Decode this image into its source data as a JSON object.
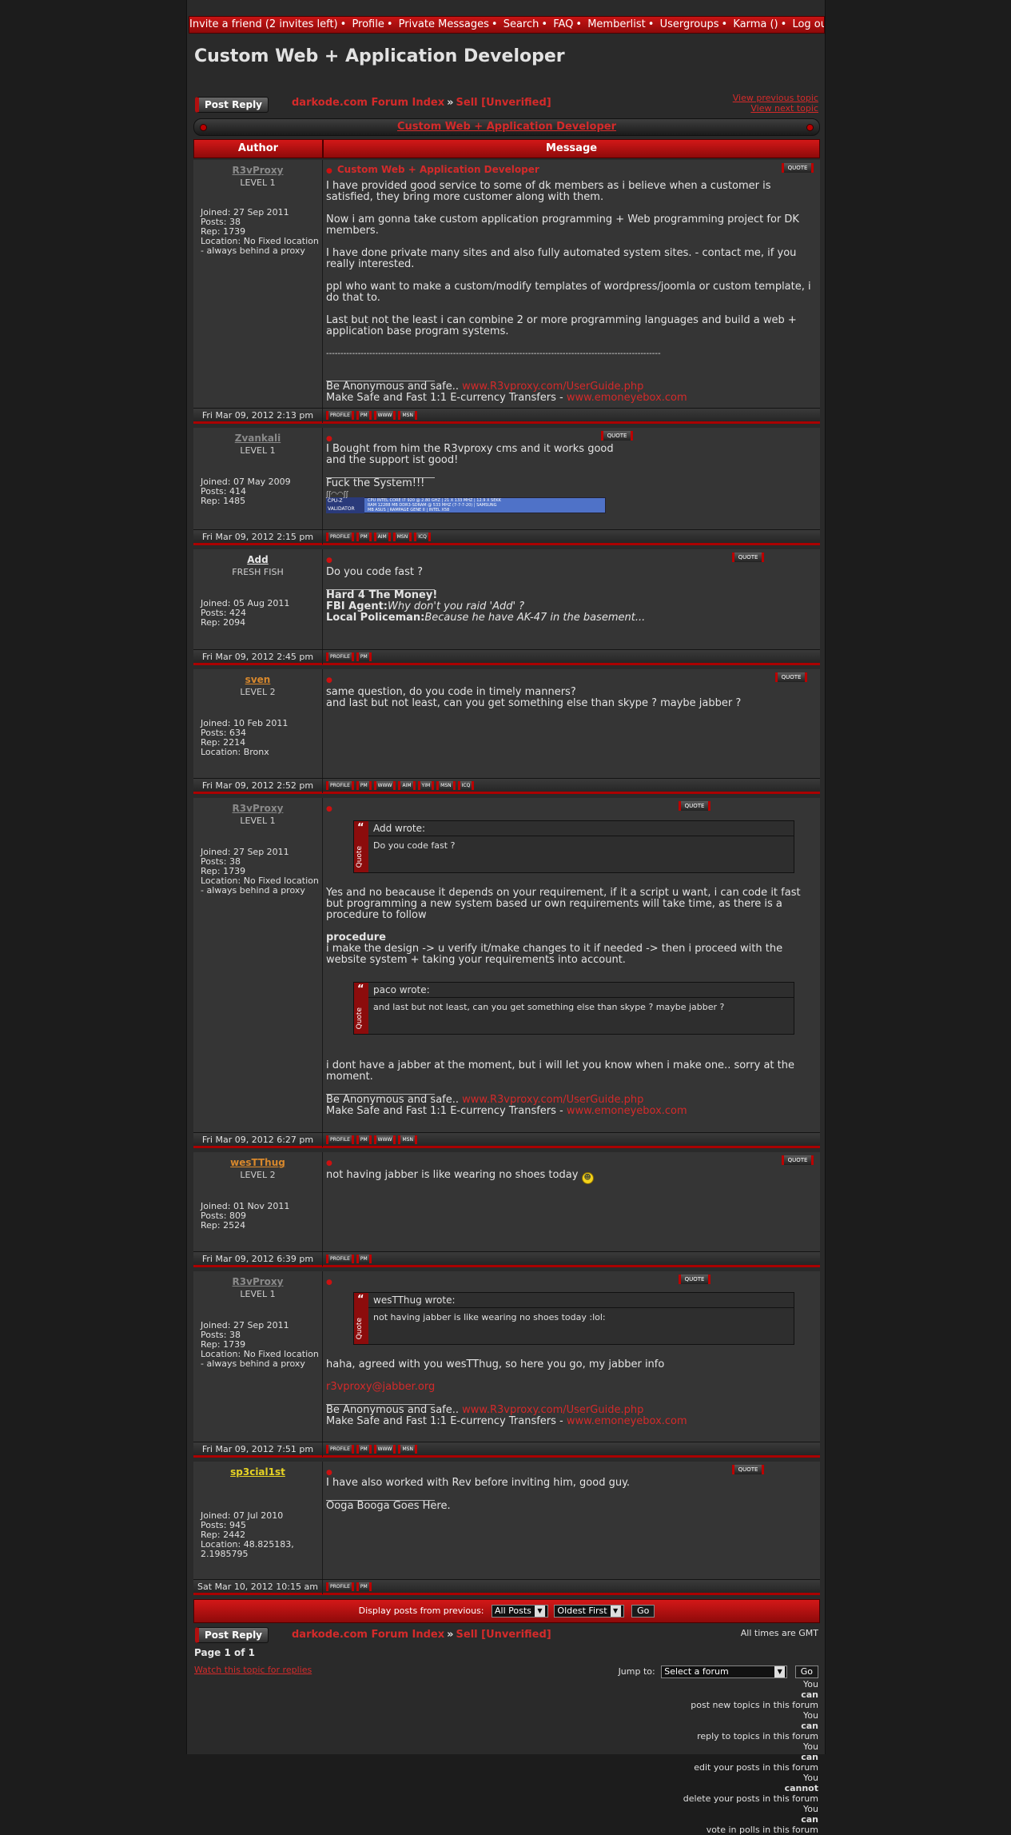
{
  "topnav": {
    "items": [
      "Invite a friend (2 invites left)",
      "Profile",
      "Private Messages",
      "Search",
      "FAQ",
      "Memberlist",
      "Usergroups",
      "Karma ()",
      "Log out [ Nassef ]"
    ]
  },
  "page_title": "Custom Web + Application Developer",
  "post_reply_label": "Post Reply",
  "breadcrumb": {
    "forum_index": "darkode.com Forum Index",
    "separator": "»",
    "forum": "Sell [Unverified]"
  },
  "view_previous": "View previous topic",
  "view_next": "View next topic",
  "topic_bar_title": "Custom Web + Application Developer",
  "table_head": {
    "author": "Author",
    "message": "Message"
  },
  "quote_btn": "QUOTE",
  "btn_labels": {
    "profile": "PROFILE",
    "pm": "PM",
    "www": "WWW",
    "aim": "AIM",
    "yim": "YIM",
    "msn": "MSN",
    "icq": "ICQ"
  },
  "quote_side": "Quote",
  "posts": [
    {
      "author": "R3vProxy",
      "rank": "LEVEL 1",
      "stats": [
        "Joined: 27 Sep 2011",
        "Posts: 38",
        "Rep: 1739",
        "Location: No Fixed location - always behind a proxy"
      ],
      "subject": "Custom Web + Application Developer",
      "paragraphs": [
        "I have provided good service to some of dk members as i believe when a customer is satisfied, they bring more customer along with them.",
        "Now i am gonna take custom application programming + Web programming project for DK members.",
        "I have done private many sites and also fully automated system sites. - contact me, if you really interested.",
        "ppl who want to make a custom/modify templates of wordpress/joomla or custom template, i do that to.",
        "Last but not the least i can combine 2 or more programming languages and build a web + application base program systems.",
        "--------------------------------------------------------------------------------------------------------------------"
      ],
      "sig1": "Be Anonymous and safe..",
      "sig1_link": "www.R3vproxy.com/UserGuide.php",
      "sig2": "Make Safe and Fast 1:1 E-currency Transfers -",
      "sig2_link": "www.emoneyebox.com",
      "date": "Fri Mar 09, 2012 2:13 pm"
    },
    {
      "author": "Zvankali",
      "rank": "LEVEL 1",
      "stats": [
        "Joined: 07 May 2009",
        "Posts: 414",
        "Rep: 1485"
      ],
      "paragraphs": [
        "I Bought from him the R3vproxy cms and it works good",
        "and the support ist good!"
      ],
      "sig": "Fuck the System!!!",
      "cpuz_label": "CPU-Z VALIDATOR",
      "cpuz_lines": [
        "CPU INTEL CORE I7 920 @ 2.80 GHZ | 21 X 133 MHZ | 12.9 X SEKK",
        "RAM 12288 MB DDR3-SDRAM @ 533 MHZ (7-7-7-20) | SAMSUNG",
        "MB ASUS | RAMPAGE GENE II | INTEL X58"
      ],
      "date": "Fri Mar 09, 2012 2:15 pm"
    },
    {
      "author": "Add",
      "rank": "FRESH FISH",
      "stats": [
        "Joined: 05 Aug 2011",
        "Posts: 424",
        "Rep: 2094"
      ],
      "text": "Do you code fast ?",
      "sig_a": "Hard 4 The Money!",
      "sig_b_label": "FBI Agent:",
      "sig_b": "Why don't you raid 'Add' ?",
      "sig_c_label": "Local Policeman:",
      "sig_c": "Because he have AK-47 in the basement...",
      "date": "Fri Mar 09, 2012 2:45 pm"
    },
    {
      "author": "sven",
      "rank": "LEVEL 2",
      "stats": [
        "Joined: 10 Feb 2011",
        "Posts: 634",
        "Rep: 2214",
        "Location: Bronx"
      ],
      "paragraphs": [
        "same question, do you code in timely manners?",
        "and last but not least, can you get something else than skype ? maybe jabber ?"
      ],
      "date": "Fri Mar 09, 2012 2:52 pm"
    },
    {
      "author": "R3vProxy",
      "rank": "LEVEL 1",
      "stats": [
        "Joined: 27 Sep 2011",
        "Posts: 38",
        "Rep: 1739",
        "Location: No Fixed location - always behind a proxy"
      ],
      "quote1_head": "Add wrote:",
      "quote1_body": "Do you code fast ?",
      "para1": "Yes and no beacause it depends on your requirement, if it a script u want, i can code it fast but programming a new system based ur own requirements will take time, as there is a procedure to follow",
      "bold": "procedure",
      "para2": "i make the design -> u verify it/make changes to it if needed -> then i proceed with the website system + taking your requirements into account.",
      "quote2_head": "paco wrote:",
      "quote2_body": "and last but not least, can you get something else than skype ? maybe jabber ?",
      "para3": "i dont have a jabber at the moment, but i will let you know when i make one.. sorry at the moment.",
      "date": "Fri Mar 09, 2012 6:27 pm"
    },
    {
      "author": "wesTThug",
      "rank": "LEVEL 2",
      "stats": [
        "Joined: 01 Nov 2011",
        "Posts: 809",
        "Rep: 2524"
      ],
      "text": "not having jabber is like wearing no shoes today",
      "date": "Fri Mar 09, 2012 6:39 pm"
    },
    {
      "author": "R3vProxy",
      "rank": "LEVEL 1",
      "stats": [
        "Joined: 27 Sep 2011",
        "Posts: 38",
        "Rep: 1739",
        "Location: No Fixed location - always behind a proxy"
      ],
      "quote_head": "wesTThug wrote:",
      "quote_body": "not having jabber is like wearing no shoes today :lol:",
      "text": "haha, agreed with you wesTThug, so here you go, my jabber info",
      "jabber": "r3vproxy@jabber.org",
      "date": "Fri Mar 09, 2012 7:51 pm"
    },
    {
      "author": "sp3cial1st",
      "rank": "",
      "stats": [
        "Joined: 07 Jul 2010",
        "Posts: 945",
        "Rep: 2442",
        "Location: 48.825183, 2.1985795"
      ],
      "text": "I have also worked with Rev before inviting him, good guy.",
      "sig": "Ooga Booga Goes Here.",
      "date": "Sat Mar 10, 2012 10:15 am"
    }
  ],
  "bottombar": {
    "label": "Display posts from previous:",
    "sel1": "All Posts",
    "sel2": "Oldest First",
    "go": "Go"
  },
  "all_times": "All times are GMT",
  "page_of": "Page 1 of 1",
  "watch": "Watch this topic for replies",
  "jump_to": {
    "label": "Jump to:",
    "placeholder": "Select a forum",
    "go": "Go"
  },
  "permissions": [
    [
      "You ",
      "can",
      " post new topics in this forum"
    ],
    [
      "You ",
      "can",
      " reply to topics in this forum"
    ],
    [
      "You ",
      "can",
      " edit your posts in this forum"
    ],
    [
      "You ",
      "cannot",
      " delete your posts in this forum"
    ],
    [
      "You ",
      "can",
      " vote in polls in this forum"
    ]
  ],
  "colors": {
    "accent": "#d42a2a",
    "bar_red": "#c81414",
    "bg": "#2a2a2a",
    "cell": "#353535"
  }
}
